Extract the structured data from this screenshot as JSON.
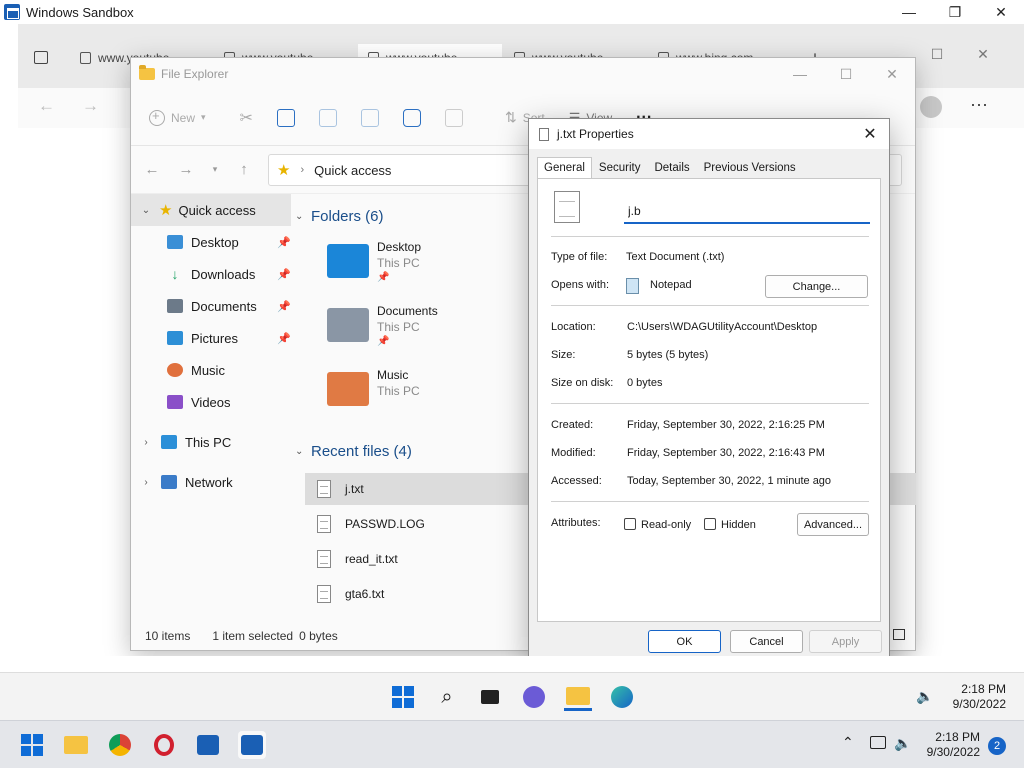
{
  "sandbox": {
    "title": "Windows Sandbox"
  },
  "browser": {
    "tabs": [
      "www.youtube",
      "www.youtube",
      "www.youtube",
      "www.youtube",
      "www.bing.com"
    ]
  },
  "explorer": {
    "title": "File Explorer",
    "toolbar": {
      "new_label": "New",
      "sort_label": "Sort",
      "view_label": "View",
      "more_label": "···"
    },
    "address": "Quick access",
    "nav": {
      "quick_access": "Quick access",
      "items": [
        {
          "label": "Desktop",
          "icon": "desktop-icon",
          "color": "#3a8fd6"
        },
        {
          "label": "Downloads",
          "icon": "download-icon",
          "color": "#21a366"
        },
        {
          "label": "Documents",
          "icon": "documents-icon",
          "color": "#6c7a89"
        },
        {
          "label": "Pictures",
          "icon": "pictures-icon",
          "color": "#2d8fd6"
        },
        {
          "label": "Music",
          "icon": "music-icon",
          "color": "#e0703d"
        },
        {
          "label": "Videos",
          "icon": "videos-icon",
          "color": "#8a4fc8"
        }
      ],
      "this_pc": "This PC",
      "network": "Network"
    },
    "folders_header": "Folders (6)",
    "folders": [
      {
        "name": "Desktop",
        "sub": "This PC",
        "color": "#1b86d8"
      },
      {
        "name": "Documents",
        "sub": "This PC",
        "color": "#8a96a5"
      },
      {
        "name": "Music",
        "sub": "This PC",
        "color": "#e07a44"
      }
    ],
    "recent_header": "Recent files (4)",
    "recent": [
      "j.txt",
      "PASSWD.LOG",
      "read_it.txt",
      "gta6.txt"
    ],
    "status": {
      "count": "10 items",
      "selected": "1 item selected",
      "size": "0 bytes"
    }
  },
  "properties": {
    "title": "j.txt Properties",
    "tabs": [
      "General",
      "Security",
      "Details",
      "Previous Versions"
    ],
    "name_value": "j.b",
    "type_label": "Type of file:",
    "type_value": "Text Document (.txt)",
    "opens_label": "Opens with:",
    "opens_value": "Notepad",
    "change_label": "Change...",
    "location_label": "Location:",
    "location_value": "C:\\Users\\WDAGUtilityAccount\\Desktop",
    "size_label": "Size:",
    "size_value": "5 bytes (5 bytes)",
    "disk_label": "Size on disk:",
    "disk_value": "0 bytes",
    "created_label": "Created:",
    "created_value": "Friday, September 30, 2022, 2:16:25 PM",
    "modified_label": "Modified:",
    "modified_value": "Friday, September 30, 2022, 2:16:43 PM",
    "accessed_label": "Accessed:",
    "accessed_value": "Today, September 30, 2022, 1 minute ago",
    "attributes_label": "Attributes:",
    "readonly_label": "Read-only",
    "hidden_label": "Hidden",
    "advanced_label": "Advanced...",
    "ok_label": "OK",
    "cancel_label": "Cancel",
    "apply_label": "Apply"
  },
  "taskbar_inner": {
    "time": "2:18 PM",
    "date": "9/30/2022"
  },
  "taskbar_host": {
    "time": "2:18 PM",
    "date": "9/30/2022",
    "badge": "2"
  }
}
